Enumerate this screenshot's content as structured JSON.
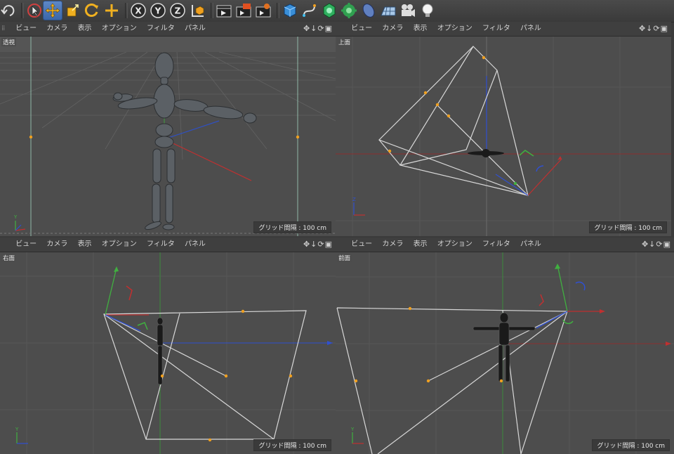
{
  "viewport_menu": [
    "ビュー",
    "カメラ",
    "表示",
    "オプション",
    "フィルタ",
    "パネル"
  ],
  "viewports": [
    {
      "label": "透視",
      "grid_label": "グリッド間隔 : 100 cm"
    },
    {
      "label": "上面",
      "grid_label": "グリッド間隔 : 100 cm"
    },
    {
      "label": "右面",
      "grid_label": "グリッド間隔 : 100 cm"
    },
    {
      "label": "前面",
      "grid_label": "グリッド間隔 : 100 cm"
    }
  ],
  "toolbar": {
    "x_label": "X",
    "y_label": "Y",
    "z_label": "Z"
  },
  "colors": {
    "x_axis": "#c83030",
    "y_axis": "#3aa83a",
    "z_axis": "#3050d0",
    "camera_frame": "#d8d8d8",
    "handle": "#f0a020",
    "mannequin": "#5a5f64",
    "active_tool": "#4a78b8"
  },
  "icons": {
    "undo": "undo-icon",
    "live_select": "live-selection-icon",
    "move": "move-icon",
    "scale": "scale-icon",
    "rotate": "rotate-icon",
    "create": "create-object-icon",
    "coords": "world-coordinates-icon",
    "render_view": "render-view-icon",
    "render_po": "render-picture-viewer-icon",
    "render_settings": "render-settings-icon",
    "cube": "cube-icon",
    "spline": "spline-icon",
    "nurbs": "generator-icon",
    "deformer": "deformer-icon",
    "sphere": "environment-icon",
    "floor": "floor-grid-icon",
    "camera": "camera-icon",
    "light": "light-icon"
  }
}
